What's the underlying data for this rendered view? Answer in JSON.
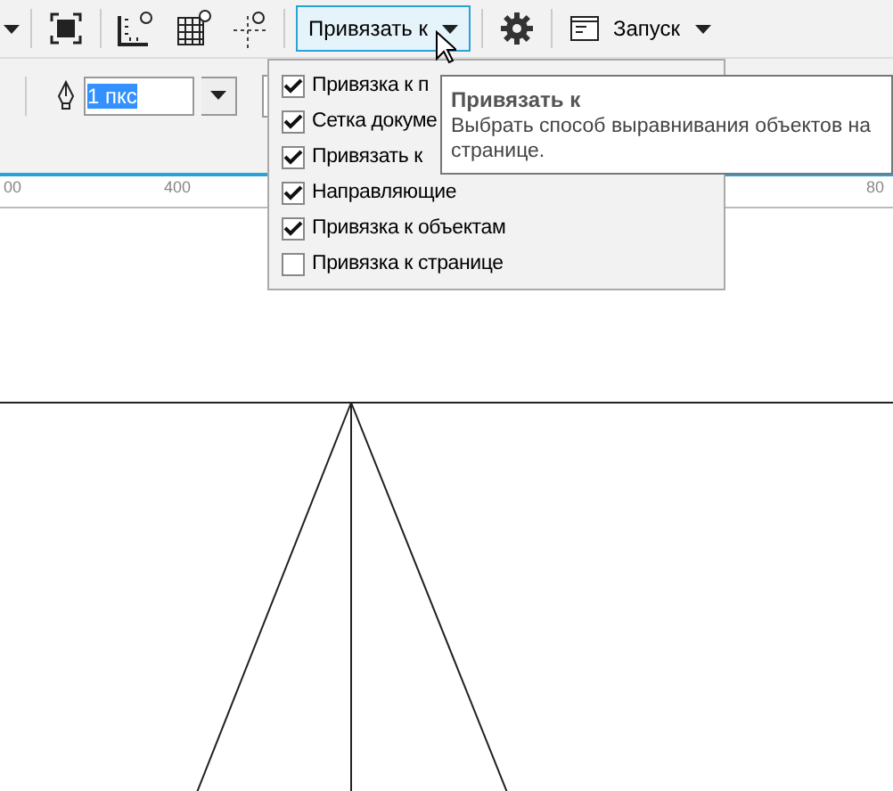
{
  "toolbar": {
    "snap_button": {
      "label": "Привязать к",
      "selected": true
    },
    "launch_button": {
      "label": "Запуск"
    }
  },
  "property_bar": {
    "outline_width": "1 пкс"
  },
  "ruler": {
    "labels": [
      "00",
      "400",
      "80"
    ]
  },
  "snap_menu": {
    "items": [
      {
        "label": "Привязка к п",
        "checked": true
      },
      {
        "label": "Сетка докуме",
        "checked": true
      },
      {
        "label": "Привязать к",
        "checked": true
      },
      {
        "label": "Направляющие",
        "checked": true
      },
      {
        "label": "Привязка к объектам",
        "checked": true
      },
      {
        "label": "Привязка к странице",
        "checked": false
      }
    ]
  },
  "tooltip": {
    "title": "Привязать к",
    "text": "Выбрать способ выравнивания объектов на странице."
  }
}
